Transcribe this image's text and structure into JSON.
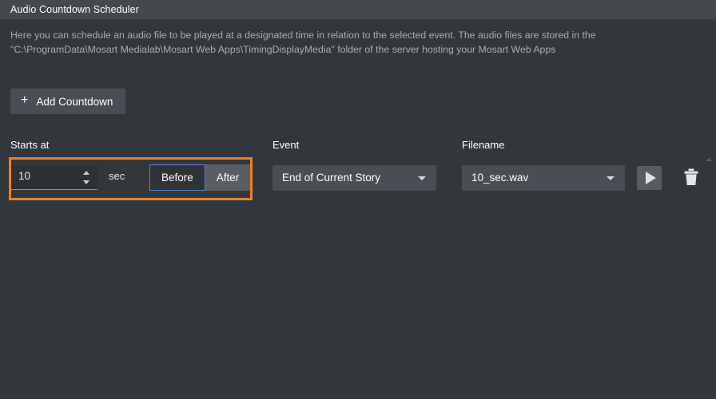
{
  "window": {
    "title": "Audio Countdown Scheduler"
  },
  "description": {
    "line1": "Here you can schedule an audio file to be played at a designated time in relation to the selected event. The audio files are stored in the",
    "line2": "\"C:\\ProgramData\\Mosart Medialab\\Mosart Web Apps\\TimingDisplayMedia\" folder of the server hosting your Mosart Web Apps"
  },
  "toolbar": {
    "add_countdown_label": "Add Countdown",
    "add_countdown_icon": "plus-icon",
    "plus_glyph": "+"
  },
  "columns": {
    "starts_at": "Starts at",
    "event": "Event",
    "filename": "Filename"
  },
  "row": {
    "duration_value": "10",
    "duration_unit": "sec",
    "direction": {
      "before_label": "Before",
      "after_label": "After",
      "selected": "Before"
    },
    "event": {
      "selected": "End of Current Story",
      "caret_icon": "chevron-down-icon"
    },
    "filename": {
      "selected": "10_sec.wav",
      "caret_icon": "chevron-down-icon"
    },
    "play_icon": "play-icon",
    "delete_icon": "trash-icon"
  },
  "colors": {
    "titlebar": "#45484d",
    "background": "#33373c",
    "highlight_outline": "#f0801f",
    "focus_ring": "#4f7fd8",
    "control": "#4a4e54",
    "toggle_unselected": "#595e65",
    "text_primary": "#ffffff",
    "text_muted": "#a8adb3"
  },
  "scroll": {
    "up_indicator_icon": "scroll-up-icon"
  }
}
